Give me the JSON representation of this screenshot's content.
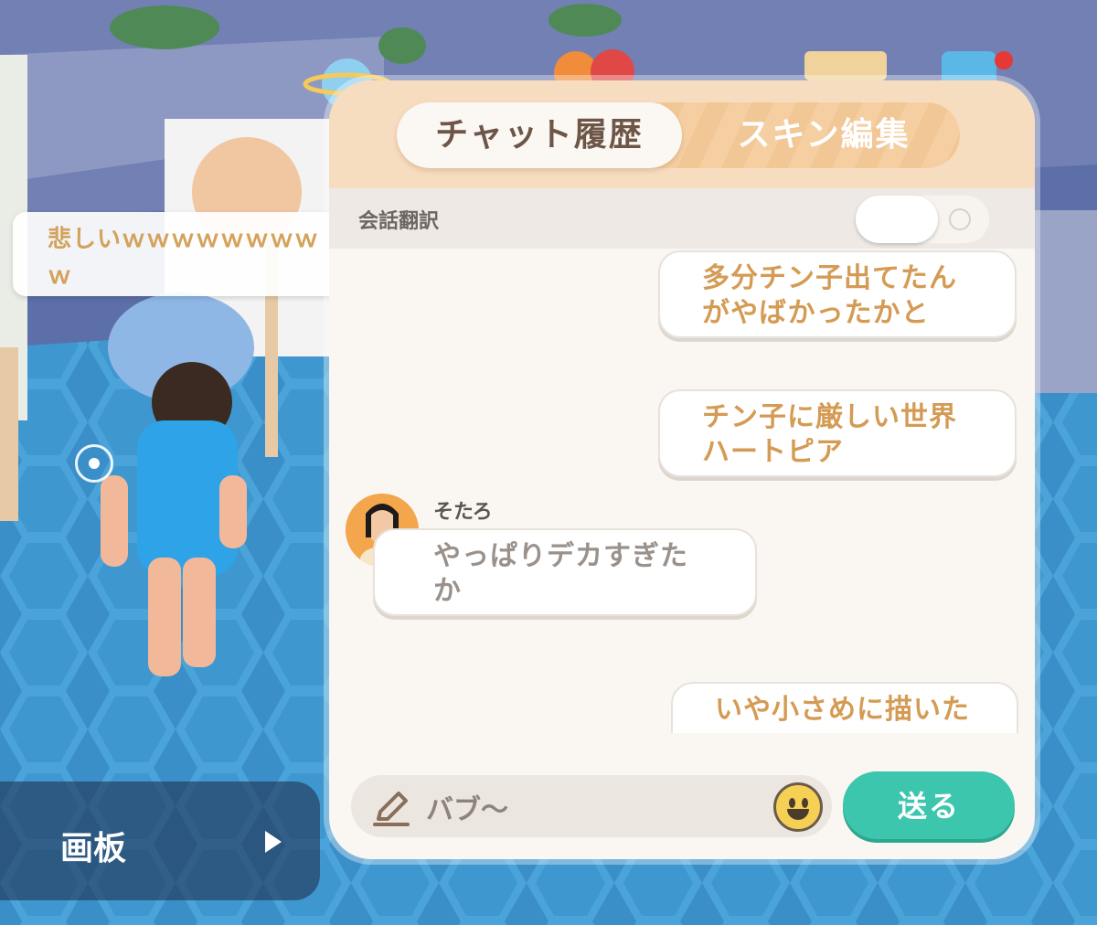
{
  "world": {
    "speech_bubble": "悲しいｗｗｗｗｗｗｗｗｗ",
    "canvas_panel_label": "画板"
  },
  "chat": {
    "tabs": [
      {
        "label": "チャット履歴",
        "active": true
      },
      {
        "label": "スキン編集",
        "active": false
      }
    ],
    "translation": {
      "label": "会話翻訳",
      "enabled": false
    },
    "messages": [
      {
        "side": "mine",
        "text": "多分チン子出てたん\nがやばかったかと"
      },
      {
        "side": "mine",
        "text": "チン子に厳しい世界\nハートピア"
      },
      {
        "side": "theirs",
        "sender": "そたろ",
        "text": "やっぱりデカすぎた\nか"
      },
      {
        "side": "mine",
        "text": "いや小さめに描いた"
      }
    ],
    "input": {
      "value": "バブ～"
    },
    "send_label": "送る"
  },
  "colors": {
    "tab_bar": "#f7ddc0",
    "mine_text": "#d49b54",
    "theirs_text": "#9a918b",
    "send_button": "#3cc6ad"
  },
  "icons": [
    "pencil-icon",
    "emoji-icon",
    "play-arrow-icon",
    "target-icon"
  ]
}
